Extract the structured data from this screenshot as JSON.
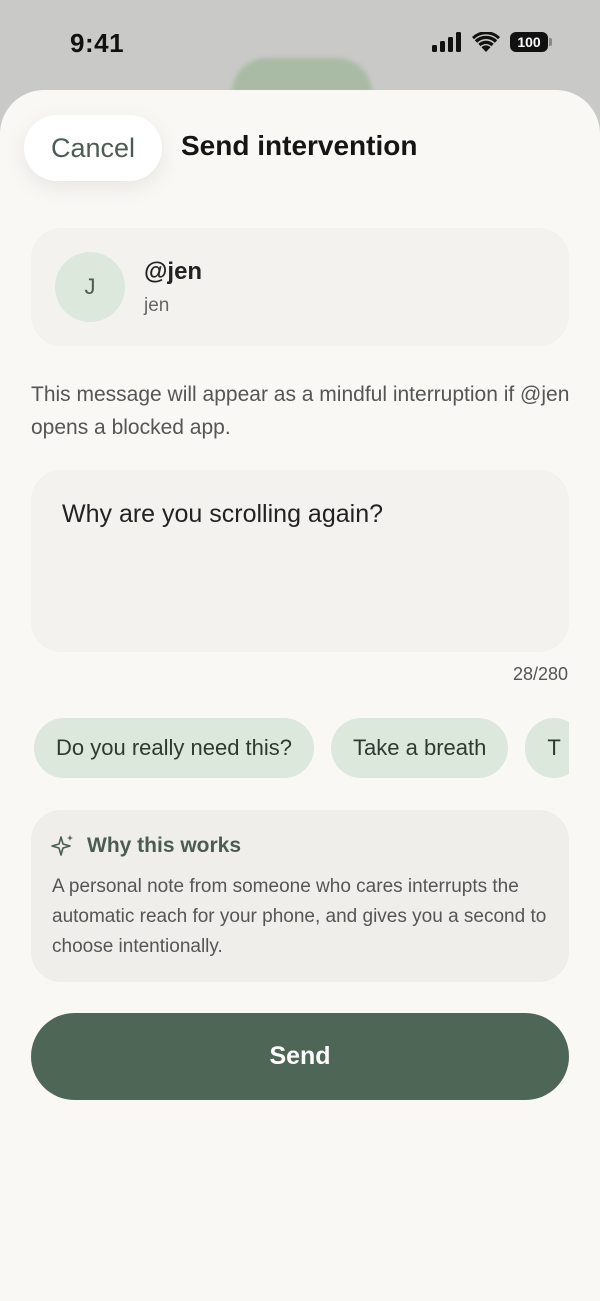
{
  "status_bar": {
    "time": "9:41",
    "battery": "100"
  },
  "header": {
    "cancel_label": "Cancel",
    "title": "Send intervention"
  },
  "recipient": {
    "avatar_initial": "J",
    "handle": "@jen",
    "name": "jen"
  },
  "info_text": "This message will appear as a mindful interruption if @jen opens a blocked app.",
  "message": {
    "value": "Why are you scrolling again?",
    "char_count": "28/280"
  },
  "suggestions": [
    "Do you really need this?",
    "Take a breath",
    "T"
  ],
  "tip": {
    "icon": "sparkle-icon",
    "title": "Why this works",
    "body": "A personal note from someone who cares interrupts the automatic reach for your phone, and gives you a second to choose intentionally."
  },
  "send_label": "Send",
  "colors": {
    "accent": "#4e6655",
    "chip_bg": "#dce8dc",
    "sheet_bg": "#f9f8f5"
  }
}
